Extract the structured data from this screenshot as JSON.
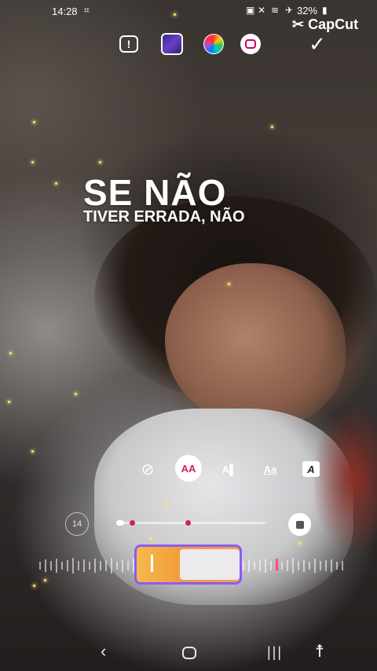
{
  "status_bar": {
    "time": "14:28",
    "battery": "32%",
    "icons": [
      "screenshot-icon",
      "battery-saver-icon",
      "mute-icon",
      "wifi-icon",
      "airplane-icon",
      "battery-icon"
    ]
  },
  "watermark": {
    "text": "CapCut"
  },
  "toolbar": {
    "warning_label": "!",
    "items": [
      "alert-icon",
      "background-style-icon",
      "color-wheel-icon",
      "sticker-icon",
      "confirm-check-icon"
    ]
  },
  "caption": {
    "line1": "SE NÃO",
    "line2": "TIVER ERRADA, NÃO"
  },
  "text_styles": {
    "none_glyph": "⃠",
    "active_label": "AA",
    "ai_label": "A▌",
    "underline_label": "Aa",
    "box_label": "A"
  },
  "slider": {
    "size_value": "14",
    "level": 0.05
  },
  "colors": {
    "accent": "#d81b60",
    "frame": "#8b5cf6",
    "marker": "#ff4f7b"
  },
  "nav": {
    "back": "‹",
    "recent": "|||",
    "accessibility": "☨"
  }
}
